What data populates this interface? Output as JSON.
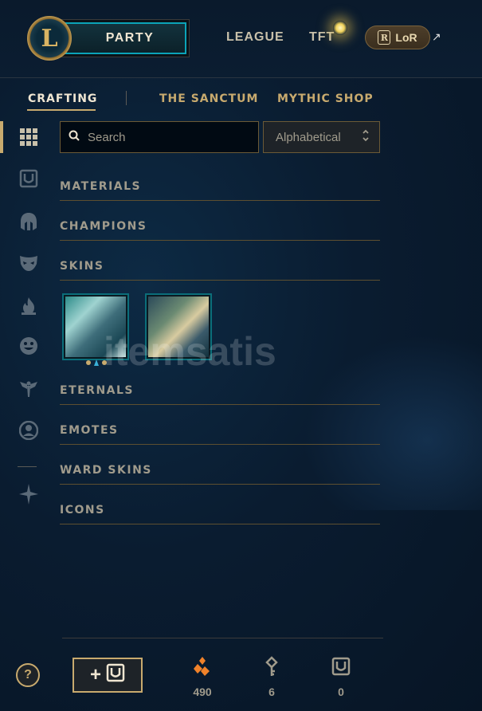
{
  "topnav": {
    "logo_letter": "L",
    "party_label": "PARTY",
    "league_label": "LEAGUE",
    "tft_label": "TFT",
    "lor_label": "LoR",
    "lor_badge": "R",
    "external_arrow": "↗"
  },
  "subtabs": {
    "crafting": "CRAFTING",
    "sanctum": "THE SANCTUM",
    "mythic_shop": "MYTHIC SHOP"
  },
  "sidebar": {
    "icons": [
      "grid-icon",
      "chest-icon",
      "helmet-icon",
      "mask-icon",
      "flame-icon",
      "emote-face-icon",
      "ward-icon",
      "profile-icon",
      "spiral-icon"
    ]
  },
  "search": {
    "placeholder": "Search",
    "value": ""
  },
  "sort": {
    "selected": "Alphabetical"
  },
  "categories": {
    "materials": "MATERIALS",
    "champions": "CHAMPIONS",
    "skins": "SKINS",
    "eternals": "ETERNALS",
    "emotes": "EMOTES",
    "ward_skins": "WARD SKINS",
    "icons": "ICONS"
  },
  "skins": [
    {
      "icon": "skin-thumbnail"
    },
    {
      "icon": "skin-thumbnail"
    }
  ],
  "watermark": {
    "text": "itemsatis"
  },
  "footer": {
    "help_label": "?",
    "add_chest_plus": "+",
    "currencies": [
      {
        "icon": "orange-essence-icon",
        "value": "490",
        "color": "#f0822a"
      },
      {
        "icon": "key-icon",
        "value": "6",
        "color": "#a09b8c"
      },
      {
        "icon": "chest-icon",
        "value": "0",
        "color": "#a09b8c"
      }
    ]
  },
  "colors": {
    "gold": "#c8aa6e",
    "teal": "#0ba3b8",
    "text_muted": "#a09b8c",
    "orange": "#f0822a"
  }
}
